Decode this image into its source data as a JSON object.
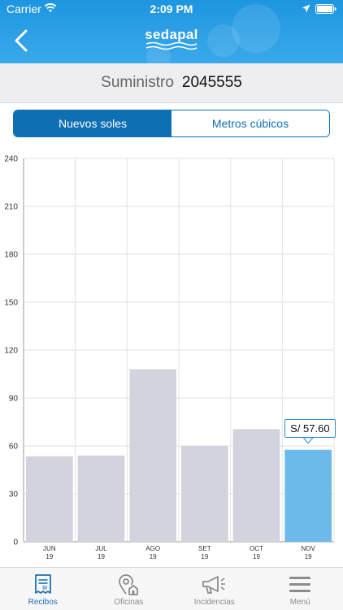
{
  "status_bar": {
    "carrier": "Carrier",
    "time": "2:09 PM"
  },
  "header": {
    "logo_text": "sedapal",
    "brand_color": "#1e95e0"
  },
  "suministro": {
    "label": "Suministro",
    "number": "2045555"
  },
  "segmented": {
    "options": [
      "Nuevos soles",
      "Metros cúbicos"
    ],
    "selected": "Nuevos soles"
  },
  "chart_data": {
    "type": "bar",
    "categories": [
      "JUN 19",
      "JUL 19",
      "AGO 19",
      "SET 19",
      "OCT 19",
      "NOV 19"
    ],
    "category_lines": [
      [
        "JUN",
        "19"
      ],
      [
        "JUL",
        "19"
      ],
      [
        "AGO",
        "19"
      ],
      [
        "SET",
        "19"
      ],
      [
        "OCT",
        "19"
      ],
      [
        "NOV",
        "19"
      ]
    ],
    "values": [
      53.5,
      54,
      108,
      60,
      70.5,
      57.6
    ],
    "ylim": [
      0,
      240
    ],
    "yticks": [
      0,
      30,
      60,
      90,
      120,
      150,
      180,
      210,
      240
    ],
    "grid": true,
    "highlight_index": 5,
    "tooltip": "S/ 57.60",
    "bar_color": "#d3d3dd",
    "highlight_color": "#6cb9ea",
    "title": "",
    "xlabel": "",
    "ylabel": ""
  },
  "tab_bar": {
    "items": [
      {
        "label": "Recibos",
        "icon": "receipt-icon",
        "active": true
      },
      {
        "label": "Oficinas",
        "icon": "office-location-icon",
        "active": false
      },
      {
        "label": "Incidencias",
        "icon": "megaphone-icon",
        "active": false
      },
      {
        "label": "Menú",
        "icon": "menu-icon",
        "active": false
      }
    ]
  }
}
